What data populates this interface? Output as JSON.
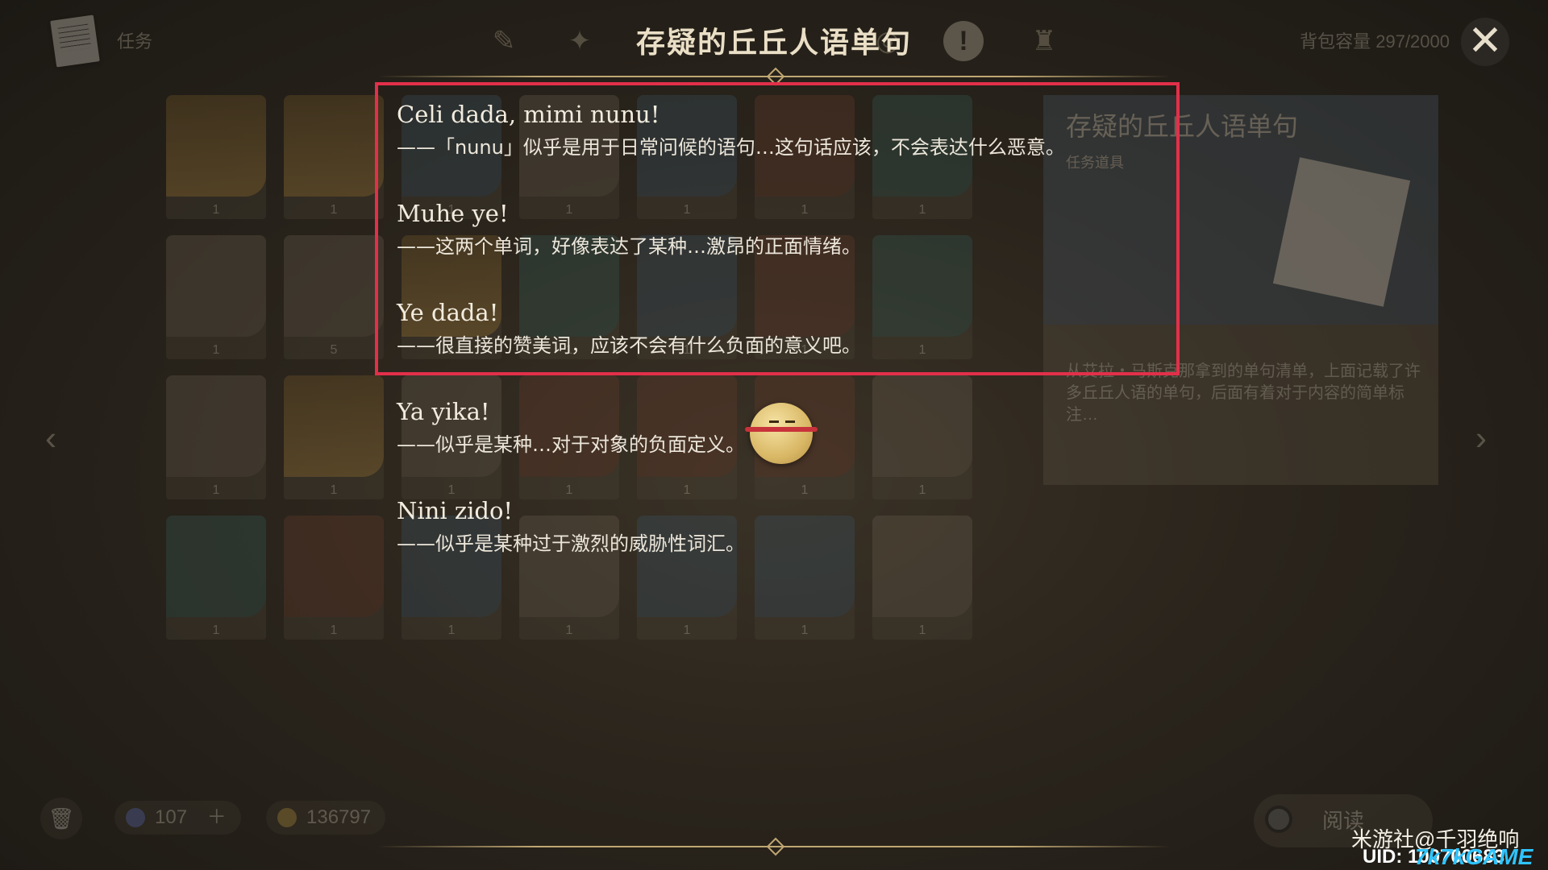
{
  "header": {
    "category_label": "任务",
    "capacity_text": "背包容量 297/2000",
    "tabs": [
      "wish-icon",
      "compass-icon",
      "alert-icon",
      "bag-icon"
    ],
    "close_glyph": "✕"
  },
  "document": {
    "title": "存疑的丘丘人语单句",
    "entries": [
      {
        "phrase": "Celi dada, mimi nunu!",
        "meaning": "——「nunu」似乎是用于日常问候的语句…这句话应该，不会表达什么恶意。"
      },
      {
        "phrase": "Muhe ye!",
        "meaning": "——这两个单词，好像表达了某种…激昂的正面情绪。"
      },
      {
        "phrase": "Ye dada!",
        "meaning": "——很直接的赞美词，应该不会有什么负面的意义吧。"
      },
      {
        "phrase": "Ya yika!",
        "meaning": "——似乎是某种…对于对象的负面定义。"
      },
      {
        "phrase": "Nini zido!",
        "meaning": "——似乎是某种过于激烈的威胁性词汇。"
      }
    ],
    "highlight_color": "#e2304a"
  },
  "inventory": {
    "slot_counts": [
      [
        "1",
        "1",
        "1",
        "1",
        "1",
        "1",
        "1"
      ],
      [
        "1",
        "5",
        "1",
        "1",
        "1",
        "1",
        "1"
      ],
      [
        "1",
        "1",
        "1",
        "1",
        "1",
        "1",
        "1"
      ],
      [
        "1",
        "1",
        "1",
        "1",
        "1",
        "1",
        "1"
      ]
    ]
  },
  "detail": {
    "name": "存疑的丘丘人语单句",
    "type": "任务道具",
    "description": "从艾拉・马斯克那拿到的单句清单，上面记载了许多丘丘人语的单句，后面有着对于内容的简单标注…"
  },
  "footer": {
    "primogems": "107",
    "mora": "136797",
    "read_button": "阅读"
  },
  "watermark": {
    "line1": "米游社@千羽绝响",
    "line2": "UID: 100700683",
    "badge": "7k7kGAME"
  },
  "colors": {
    "accent_gold": "#bfa773",
    "highlight_red": "#e2304a",
    "background": "#2a241c"
  }
}
